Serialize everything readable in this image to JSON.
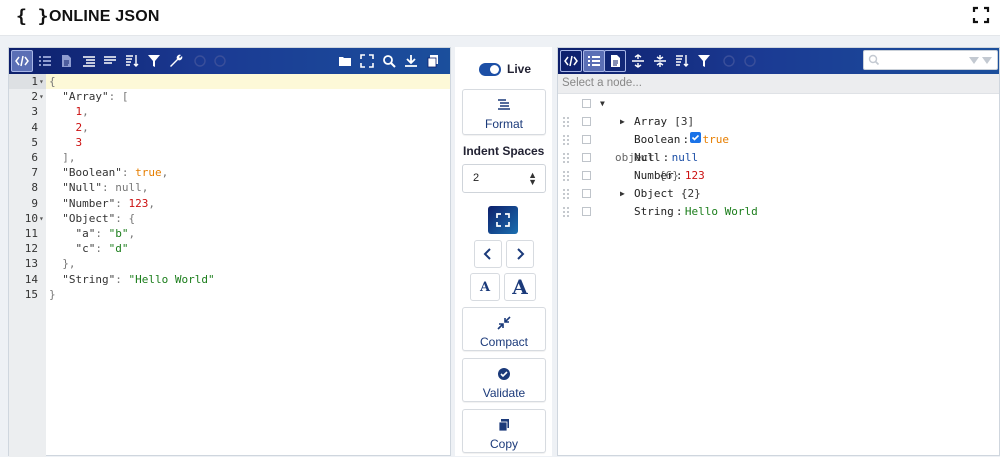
{
  "header": {
    "logo_glyph": "{ }",
    "title": "ONLINE JSON"
  },
  "editor": {
    "lines": [
      {
        "num": "1",
        "fold": true,
        "parts": [
          [
            "p",
            "{"
          ]
        ]
      },
      {
        "num": "2",
        "fold": true,
        "parts": [
          [
            "p",
            "  "
          ],
          [
            "k",
            "\"Array\""
          ],
          [
            "p",
            ": ["
          ]
        ]
      },
      {
        "num": "3",
        "fold": false,
        "parts": [
          [
            "p",
            "    "
          ],
          [
            "n",
            "1"
          ],
          [
            "p",
            ","
          ]
        ]
      },
      {
        "num": "4",
        "fold": false,
        "parts": [
          [
            "p",
            "    "
          ],
          [
            "n",
            "2"
          ],
          [
            "p",
            ","
          ]
        ]
      },
      {
        "num": "5",
        "fold": false,
        "parts": [
          [
            "p",
            "    "
          ],
          [
            "n",
            "3"
          ]
        ]
      },
      {
        "num": "6",
        "fold": false,
        "parts": [
          [
            "p",
            "  ],"
          ]
        ]
      },
      {
        "num": "7",
        "fold": false,
        "parts": [
          [
            "p",
            "  "
          ],
          [
            "k",
            "\"Boolean\""
          ],
          [
            "p",
            ": "
          ],
          [
            "b",
            "true"
          ],
          [
            "p",
            ","
          ]
        ]
      },
      {
        "num": "8",
        "fold": false,
        "parts": [
          [
            "p",
            "  "
          ],
          [
            "k",
            "\"Null\""
          ],
          [
            "p",
            ": "
          ],
          [
            "nl",
            "null"
          ],
          [
            "p",
            ","
          ]
        ]
      },
      {
        "num": "9",
        "fold": false,
        "parts": [
          [
            "p",
            "  "
          ],
          [
            "k",
            "\"Number\""
          ],
          [
            "p",
            ": "
          ],
          [
            "n",
            "123"
          ],
          [
            "p",
            ","
          ]
        ]
      },
      {
        "num": "10",
        "fold": true,
        "parts": [
          [
            "p",
            "  "
          ],
          [
            "k",
            "\"Object\""
          ],
          [
            "p",
            ": {"
          ]
        ]
      },
      {
        "num": "11",
        "fold": false,
        "parts": [
          [
            "p",
            "    "
          ],
          [
            "k",
            "\"a\""
          ],
          [
            "p",
            ": "
          ],
          [
            "s",
            "\"b\""
          ],
          [
            "p",
            ","
          ]
        ]
      },
      {
        "num": "12",
        "fold": false,
        "parts": [
          [
            "p",
            "    "
          ],
          [
            "k",
            "\"c\""
          ],
          [
            "p",
            ": "
          ],
          [
            "s",
            "\"d\""
          ]
        ]
      },
      {
        "num": "13",
        "fold": false,
        "parts": [
          [
            "p",
            "  },"
          ]
        ]
      },
      {
        "num": "14",
        "fold": false,
        "parts": [
          [
            "p",
            "  "
          ],
          [
            "k",
            "\"String\""
          ],
          [
            "p",
            ": "
          ],
          [
            "s",
            "\"Hello World\""
          ]
        ]
      },
      {
        "num": "15",
        "fold": false,
        "parts": [
          [
            "p",
            "}"
          ]
        ]
      }
    ]
  },
  "middle": {
    "live_label": "Live",
    "format_label": "Format",
    "indent_label": "Indent Spaces",
    "indent_value": "2",
    "compact_label": "Compact",
    "validate_label": "Validate",
    "copy_label": "Copy",
    "font_small": "A",
    "font_large": "A",
    "arrow_left": "<",
    "arrow_right": ">"
  },
  "tree": {
    "select_placeholder": "Select a node...",
    "root": {
      "label": "object",
      "count": "{6}"
    },
    "rows": [
      {
        "key": "Array",
        "value": "[3]",
        "type": "group"
      },
      {
        "key": "Boolean",
        "value": "true",
        "type": "bool"
      },
      {
        "key": "Null",
        "value": "null",
        "type": "null"
      },
      {
        "key": "Number",
        "value": "123",
        "type": "num"
      },
      {
        "key": "Object",
        "value": "{2}",
        "type": "group"
      },
      {
        "key": "String",
        "value": "Hello World",
        "type": "str"
      }
    ]
  },
  "colors": {
    "toolbar_start": "#0d1f6b",
    "toolbar_end": "#1b4f9c",
    "accent": "#1c4fa6",
    "string": "#1b7d1b",
    "number": "#cc1111",
    "boolean": "#e67e00",
    "null": "#1c4fa6"
  }
}
